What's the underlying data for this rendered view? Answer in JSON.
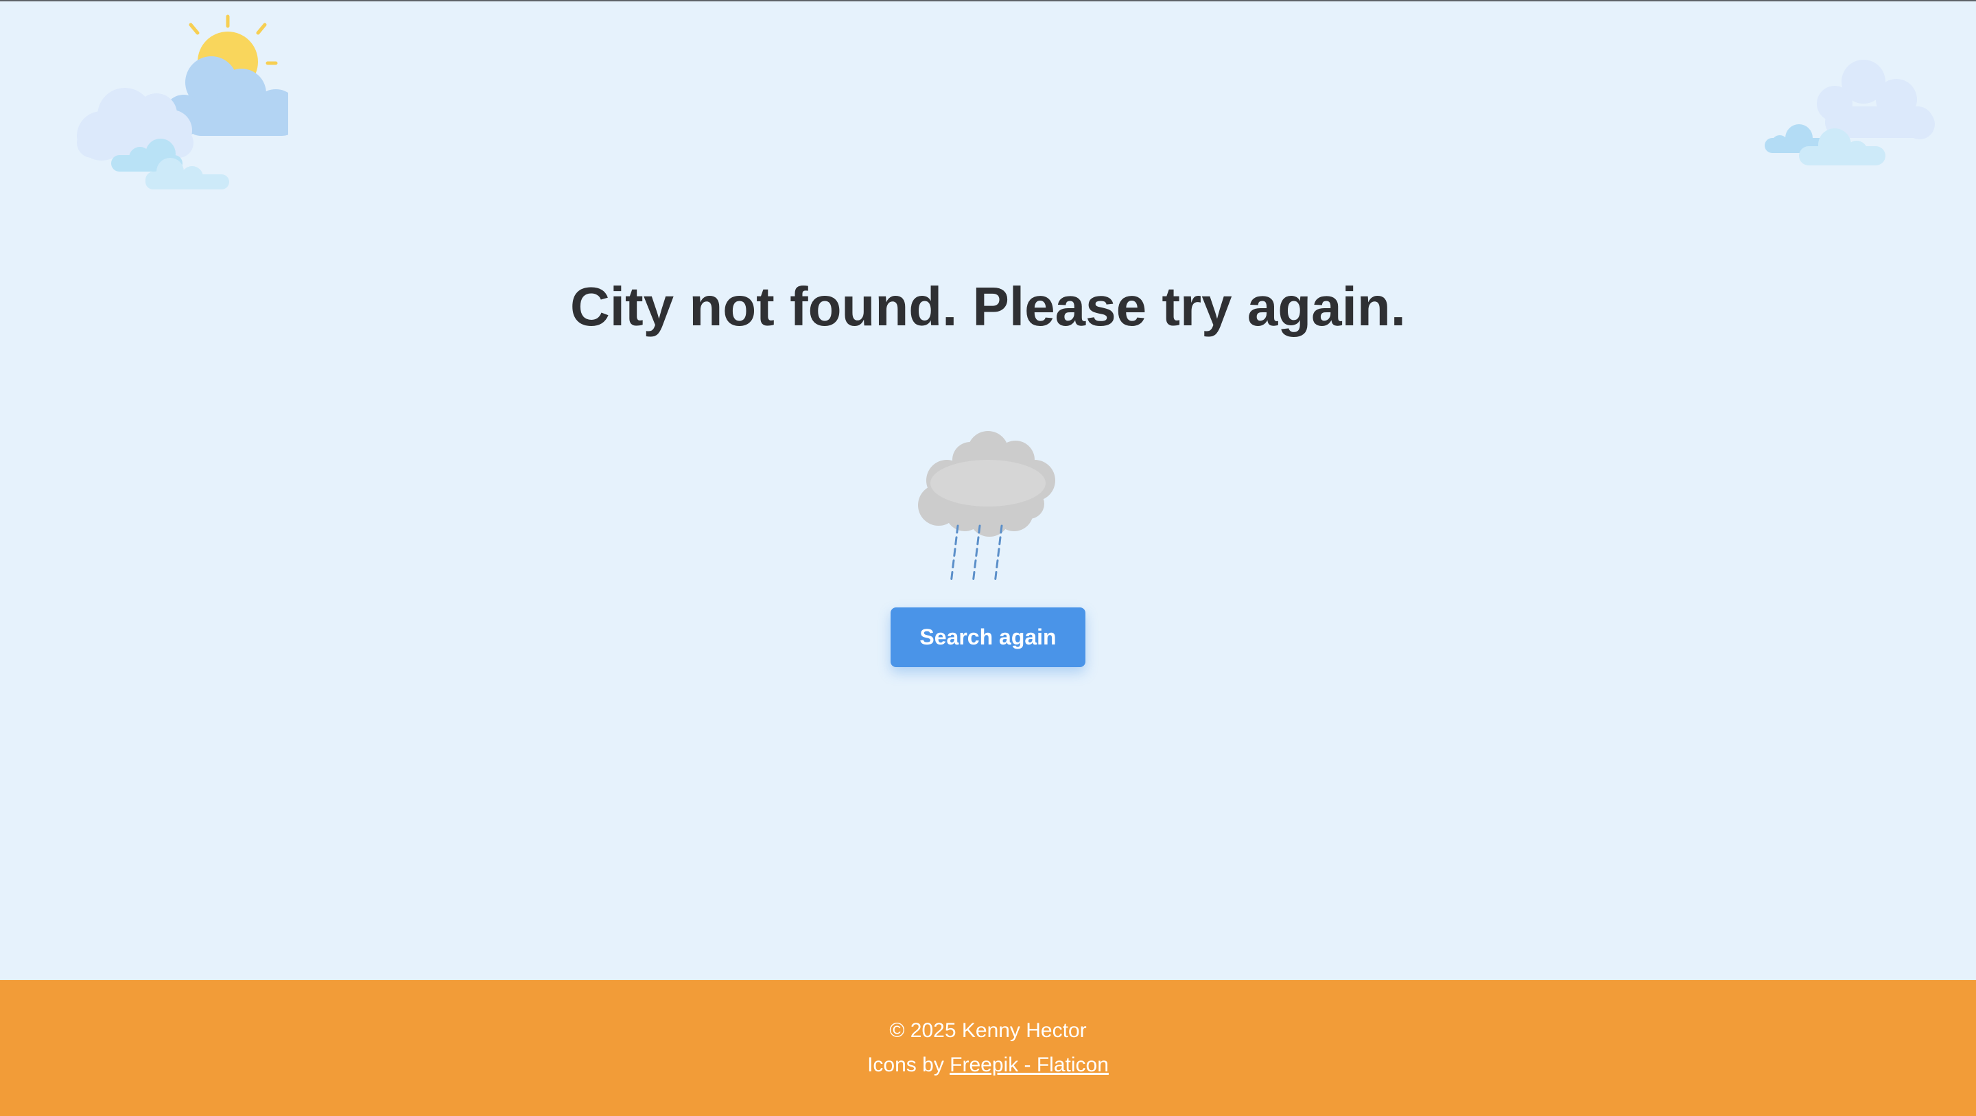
{
  "main": {
    "message": "City not found. Please try again.",
    "search_again_label": "Search again"
  },
  "footer": {
    "copyright": "© 2025 Kenny Hector",
    "credits_prefix": "Icons by ",
    "credits_link_text": "Freepik - Flaticon"
  },
  "icons": {
    "top_left": "sun-behind-clouds-icon",
    "top_right": "clouds-icon",
    "center": "rain-cloud-icon"
  },
  "colors": {
    "background": "#e6f2fc",
    "button": "#4a94e8",
    "footer": "#f29c38",
    "heading_text": "#2f3033"
  }
}
